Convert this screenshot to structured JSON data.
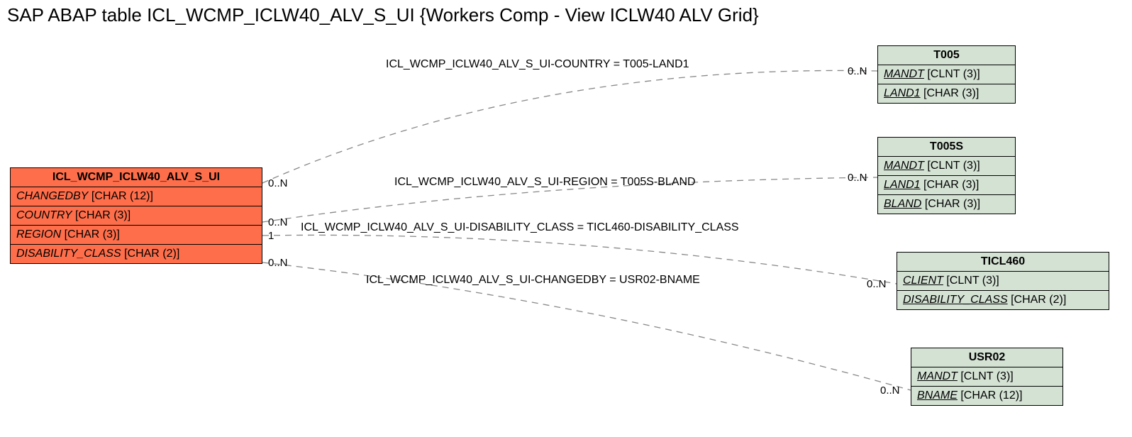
{
  "title": "SAP ABAP table ICL_WCMP_ICLW40_ALV_S_UI {Workers Comp - View ICLW40 ALV Grid}",
  "mainEntity": {
    "name": "ICL_WCMP_ICLW40_ALV_S_UI",
    "fields": [
      {
        "name": "CHANGEDBY",
        "type": "[CHAR (12)]"
      },
      {
        "name": "COUNTRY",
        "type": "[CHAR (3)]"
      },
      {
        "name": "REGION",
        "type": "[CHAR (3)]"
      },
      {
        "name": "DISABILITY_CLASS",
        "type": "[CHAR (2)]"
      }
    ]
  },
  "refEntities": {
    "t005": {
      "name": "T005",
      "fields": [
        {
          "name": "MANDT",
          "type": "[CLNT (3)]",
          "key": true
        },
        {
          "name": "LAND1",
          "type": "[CHAR (3)]",
          "key": true
        }
      ]
    },
    "t005s": {
      "name": "T005S",
      "fields": [
        {
          "name": "MANDT",
          "type": "[CLNT (3)]",
          "key": true
        },
        {
          "name": "LAND1",
          "type": "[CHAR (3)]",
          "key": true
        },
        {
          "name": "BLAND",
          "type": "[CHAR (3)]",
          "key": true
        }
      ]
    },
    "ticl460": {
      "name": "TICL460",
      "fields": [
        {
          "name": "CLIENT",
          "type": "[CLNT (3)]",
          "key": true
        },
        {
          "name": "DISABILITY_CLASS",
          "type": "[CHAR (2)]",
          "key": true
        }
      ]
    },
    "usr02": {
      "name": "USR02",
      "fields": [
        {
          "name": "MANDT",
          "type": "[CLNT (3)]",
          "key": true
        },
        {
          "name": "BNAME",
          "type": "[CHAR (12)]",
          "key": true
        }
      ]
    }
  },
  "relations": {
    "r1": {
      "label": "ICL_WCMP_ICLW40_ALV_S_UI-COUNTRY = T005-LAND1",
      "leftCard": "0..N",
      "rightCard": "0..N"
    },
    "r2": {
      "label": "ICL_WCMP_ICLW40_ALV_S_UI-REGION = T005S-BLAND",
      "leftCard": "0..N",
      "rightCard": "0..N"
    },
    "r3": {
      "label": "ICL_WCMP_ICLW40_ALV_S_UI-DISABILITY_CLASS = TICL460-DISABILITY_CLASS",
      "leftCard": "1",
      "rightCard": "0..N"
    },
    "r4": {
      "label": "ICL_WCMP_ICLW40_ALV_S_UI-CHANGEDBY = USR02-BNAME",
      "leftCard": "0..N",
      "rightCard": "0..N"
    }
  }
}
